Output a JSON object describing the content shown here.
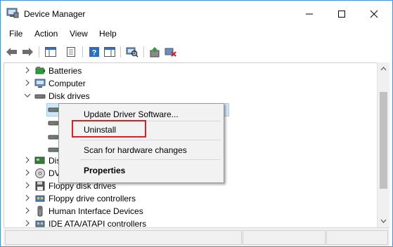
{
  "window": {
    "title": "Device Manager"
  },
  "menubar": {
    "items": [
      "File",
      "Action",
      "View",
      "Help"
    ]
  },
  "toolbar": {
    "buttons": [
      "back-icon",
      "forward-icon",
      "show-hide-console-tree-icon",
      "properties-icon",
      "help-icon",
      "action-pane-icon",
      "scan-hardware-icon",
      "update-driver-icon",
      "uninstall-device-icon"
    ]
  },
  "tree": {
    "batteries": "Batteries",
    "computer": "Computer",
    "disk_drives": "Disk drives",
    "display_partial": "Dis",
    "dvd_partial": "DV",
    "floppy_disk": "Floppy disk drives",
    "floppy_ctrl": "Floppy drive controllers",
    "hid": "Human Interface Devices",
    "ide": "IDE ATA/ATAPI controllers"
  },
  "context_menu": {
    "update": "Update Driver Software...",
    "uninstall": "Uninstall",
    "scan": "Scan for hardware changes",
    "properties": "Properties"
  },
  "colors": {
    "accent": "#4a90d9",
    "highlight": "#e02020",
    "selection": "#cce8ff"
  }
}
